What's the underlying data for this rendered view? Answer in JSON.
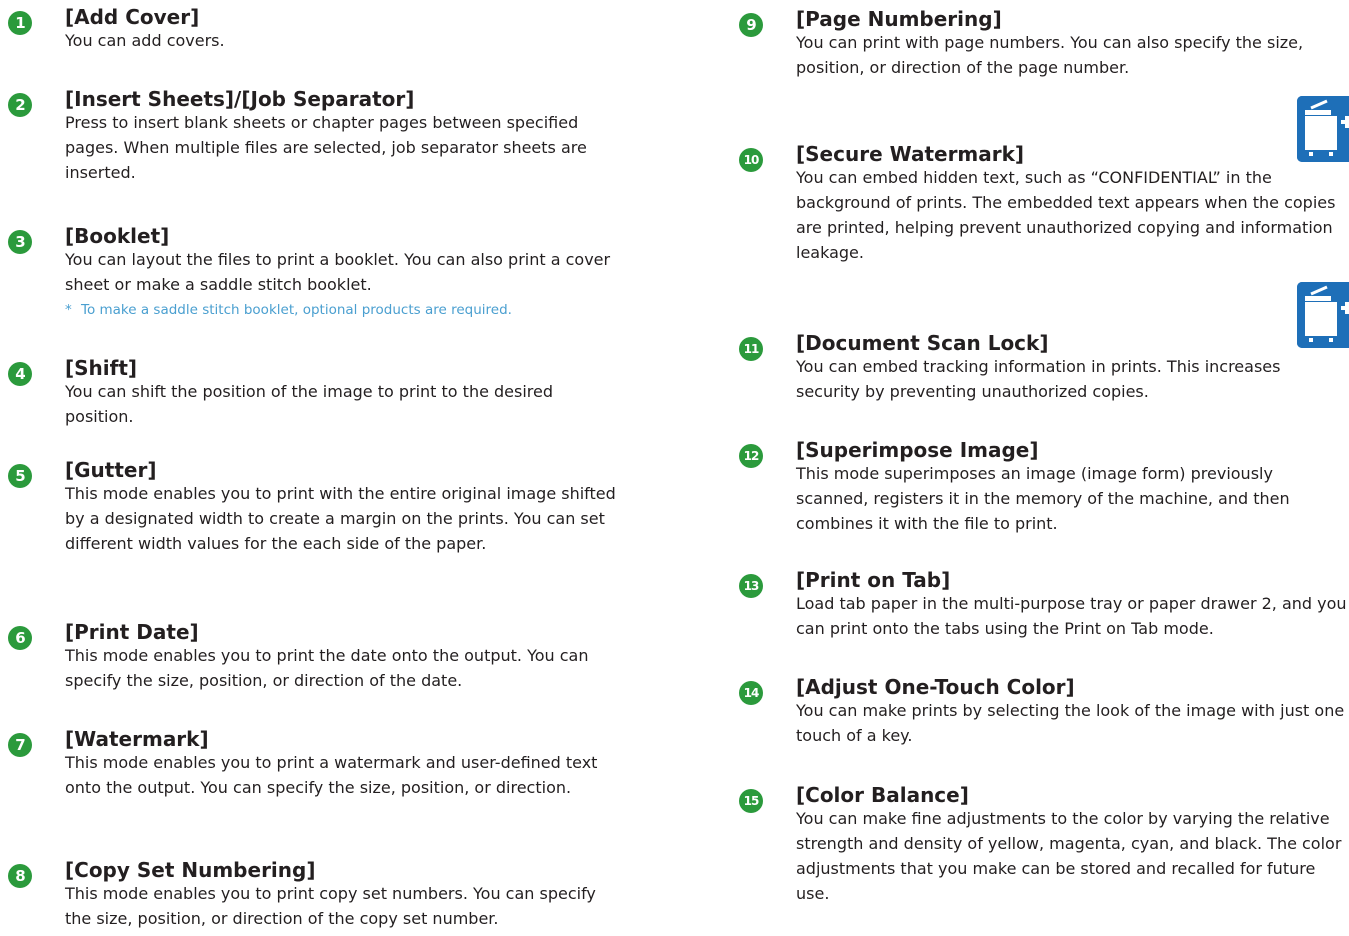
{
  "items": [
    {
      "num": "1",
      "title": "[Add Cover]",
      "text": "You can add covers."
    },
    {
      "num": "2",
      "title": "[Insert Sheets]/[Job Separator]",
      "text": "Press to insert blank sheets or chapter pages between specified pages. When multiple files are selected, job separator sheets are inserted."
    },
    {
      "num": "3",
      "title": "[Booklet]",
      "text": "You can layout the files to print a booklet. You can also print a cover sheet or make a saddle stitch booklet.",
      "note_mark": "*",
      "note": "To make a saddle stitch booklet, optional products are required."
    },
    {
      "num": "4",
      "title": "[Shift]",
      "text": "You can shift the position of the image to print to the desired position."
    },
    {
      "num": "5",
      "title": "[Gutter]",
      "text": "This mode enables you to print with the entire original image shifted by a designated width to create a margin on the prints. You can set different width values for the each side of the paper."
    },
    {
      "num": "6",
      "title": "[Print Date]",
      "text": "This mode enables you to print the date onto the output. You can specify the size, position, or direction of the date."
    },
    {
      "num": "7",
      "title": "[Watermark]",
      "text": "This mode enables you to print a watermark and user-defined text onto the output. You can specify the size, position, or direction."
    },
    {
      "num": "8",
      "title": "[Copy Set Numbering]",
      "text": "This mode enables you to print copy set numbers. You can specify the size, position, or direction of the copy set number."
    },
    {
      "num": "9",
      "title": "[Page Numbering]",
      "text": "You can print with page numbers. You can also specify the size, position, or direction of the page number."
    },
    {
      "num": "10",
      "title": "[Secure Watermark]",
      "text": "You can embed hidden text, such as “CONFIDENTIAL” in the background of prints. The embedded text appears when the copies are printed, helping prevent unauthorized copying and information leakage."
    },
    {
      "num": "11",
      "title": "[Document Scan Lock]",
      "text": "You can embed tracking information in prints. This increases security by preventing unauthorized copies."
    },
    {
      "num": "12",
      "title": "[Superimpose Image]",
      "text": "This mode superimposes an image (image form) previously scanned, registers it in the memory of the machine, and then combines it with the file to print."
    },
    {
      "num": "13",
      "title": "[Print on Tab]",
      "text": "Load tab paper in the multi-purpose tray or paper drawer 2, and you can print onto the tabs using the Print on Tab mode."
    },
    {
      "num": "14",
      "title": "[Adjust One-Touch Color]",
      "text": "You can make prints by selecting the look of the image with just one touch of a key."
    },
    {
      "num": "15",
      "title": "[Color Balance]",
      "text": "You can make fine adjustments to the color by varying the relative strength and density of yellow, magenta, cyan, and black. The color adjustments that you make can be stored and recalled for future use."
    }
  ],
  "icons": [
    "option-device-icon",
    "option-device-icon"
  ],
  "colors": {
    "badge": "#2b9a3c",
    "note": "#4a9fd0",
    "icon": "#1e6fb8",
    "text": "#231f20"
  }
}
